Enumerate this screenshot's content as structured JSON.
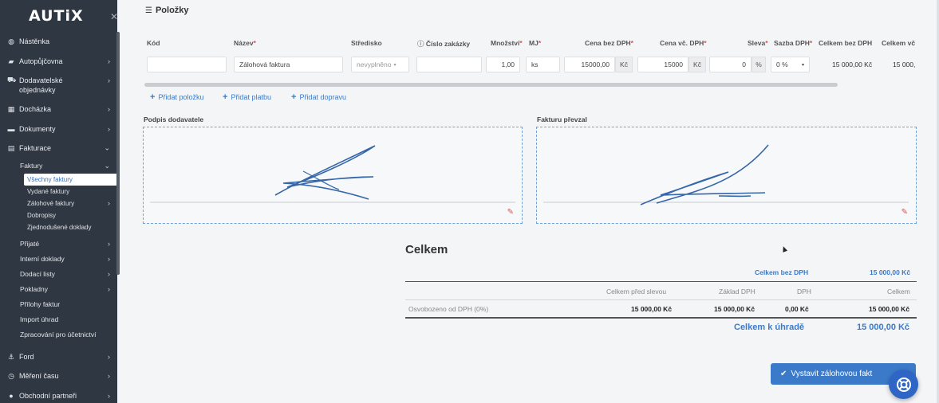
{
  "app": {
    "logo": "AUTiX"
  },
  "sidebar": {
    "items": [
      {
        "label": "Nástěnka",
        "icon": "dashboard-icon",
        "chevron": false
      },
      {
        "label": "Autopůjčovna",
        "icon": "car-icon",
        "chevron": true
      },
      {
        "label": "Dodavatelské objednávky",
        "icon": "cart-icon",
        "chevron": true
      },
      {
        "label": "Docházka",
        "icon": "calendar-icon",
        "chevron": true
      },
      {
        "label": "Dokumenty",
        "icon": "folder-icon",
        "chevron": true
      },
      {
        "label": "Fakturace",
        "icon": "invoice-icon",
        "chevron": true,
        "expanded": true
      }
    ],
    "fakturace": {
      "faktury": "Faktury",
      "faktury_children": [
        "Všechny faktury",
        "Vydané faktury",
        "Zálohové faktury",
        "Dobropisy",
        "Zjednodušené doklady"
      ],
      "others": [
        "Přijaté",
        "Interní doklady",
        "Dodací listy",
        "Pokladny",
        "Přílohy faktur",
        "Import úhrad",
        "Zpracování pro účetnictví"
      ]
    },
    "bottom": [
      {
        "label": "Ford",
        "icon": "anchor-icon"
      },
      {
        "label": "Měření času",
        "icon": "clock-icon"
      },
      {
        "label": "Obchodní partneři",
        "icon": "user-icon"
      }
    ]
  },
  "polozky": {
    "title": "Položky",
    "headers": {
      "kod": "Kód",
      "nazev": "Název",
      "stredisko": "Středisko",
      "cislo_zakazky": "Číslo zakázky",
      "mnozstvi": "Množství",
      "mj": "MJ",
      "cena_bez": "Cena bez DPH",
      "cena_vc": "Cena vč. DPH",
      "sleva": "Sleva",
      "sazba": "Sazba DPH",
      "celkem_bez": "Celkem bez DPH",
      "celkem_vc": "Celkem vč"
    },
    "row": {
      "kod": "",
      "nazev": "Zálohová faktura",
      "stredisko": "nevyplněno",
      "cislo_zakazky": "",
      "mnozstvi": "1,00",
      "mj": "ks",
      "cena_bez": "15000,00",
      "currency": "Kč",
      "cena_vc": "15000",
      "sleva": "0",
      "percent": "%",
      "sazba": "0 %",
      "celkem_bez": "15 000,00 Kč",
      "celkem_vc": "15 000,"
    },
    "actions": {
      "add_item": "Přidat položku",
      "add_payment": "Přidat platbu",
      "add_shipping": "Přidat dopravu"
    }
  },
  "signatures": {
    "supplier": "Podpis dodavatele",
    "received": "Fakturu převzal"
  },
  "totals": {
    "title": "Celkem",
    "bez_dph_label": "Celkem bez DPH",
    "bez_dph_value": "15 000,00 Kč",
    "columns": [
      "Celkem před slevou",
      "Základ DPH",
      "DPH",
      "Celkem"
    ],
    "row": {
      "label": "Osvobozeno od DPH (0%)",
      "values": [
        "15 000,00 Kč",
        "15 000,00 Kč",
        "0,00 Kč",
        "15 000,00 Kč"
      ]
    },
    "k_uhrade_label": "Celkem k úhradě",
    "k_uhrade_value": "15 000,00 Kč"
  },
  "submit": {
    "label": "Vystavit zálohovou fakt"
  },
  "colors": {
    "sidebar": "#2f3742",
    "accent": "#3b7ac9",
    "required": "#d9534f"
  }
}
